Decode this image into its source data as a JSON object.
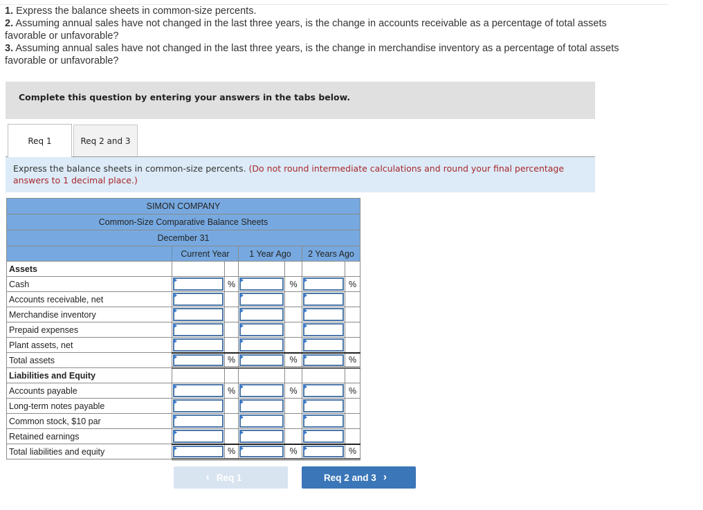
{
  "instructions": [
    {
      "num": "1.",
      "text": "Express the balance sheets in common-size percents."
    },
    {
      "num": "2.",
      "text": "Assuming annual sales have not changed in the last three years, is the change in accounts receivable as a percentage of total assets favorable or unfavorable?"
    },
    {
      "num": "3.",
      "text": "Assuming annual sales have not changed in the last three years, is the change in merchandise inventory as a percentage of total assets favorable or unfavorable?"
    }
  ],
  "banner": "Complete this question by entering your answers in the tabs below.",
  "tabs": [
    {
      "label": "Req 1",
      "active": true
    },
    {
      "label": "Req 2 and 3",
      "active": false
    }
  ],
  "prompt": {
    "text": "Express the balance sheets in common-size percents.",
    "note": "(Do not round intermediate calculations and round your final percentage answers to 1 decimal place.)"
  },
  "table": {
    "company": "SIMON COMPANY",
    "title": "Common-Size Comparative Balance Sheets",
    "date": "December 31",
    "columns": [
      "Current Year",
      "1 Year Ago",
      "2 Years Ago"
    ],
    "pct_symbol": "%",
    "rows": [
      {
        "label": "Assets",
        "type": "section"
      },
      {
        "label": "Cash",
        "type": "input",
        "pct": true,
        "values": [
          "",
          "",
          ""
        ]
      },
      {
        "label": "Accounts receivable, net",
        "type": "input",
        "pct": false,
        "values": [
          "",
          "",
          ""
        ]
      },
      {
        "label": "Merchandise inventory",
        "type": "input",
        "pct": false,
        "values": [
          "",
          "",
          ""
        ]
      },
      {
        "label": "Prepaid expenses",
        "type": "input",
        "pct": false,
        "values": [
          "",
          "",
          ""
        ]
      },
      {
        "label": "Plant assets, net",
        "type": "input",
        "pct": false,
        "values": [
          "",
          "",
          ""
        ]
      },
      {
        "label": "Total assets",
        "type": "total",
        "pct": true,
        "values": [
          "",
          "",
          ""
        ]
      },
      {
        "label": "Liabilities and Equity",
        "type": "section"
      },
      {
        "label": "Accounts payable",
        "type": "input",
        "pct": true,
        "values": [
          "",
          "",
          ""
        ]
      },
      {
        "label": "Long-term notes payable",
        "type": "input",
        "pct": false,
        "values": [
          "",
          "",
          ""
        ]
      },
      {
        "label": "Common stock, $10 par",
        "type": "input",
        "pct": false,
        "values": [
          "",
          "",
          ""
        ]
      },
      {
        "label": "Retained earnings",
        "type": "input",
        "pct": false,
        "values": [
          "",
          "",
          ""
        ]
      },
      {
        "label": "Total liabilities and equity",
        "type": "total",
        "pct": true,
        "values": [
          "",
          "",
          ""
        ]
      }
    ]
  },
  "nav": {
    "prev_label": "Req 1",
    "next_label": "Req 2 and 3",
    "prev_icon": "chevron-left-icon",
    "next_icon": "chevron-right-icon"
  },
  "colors": {
    "header_blue": "#77a9e0",
    "prompt_bg": "#dcebf7",
    "note_red": "#a8262b",
    "next_button": "#3a76b8",
    "prev_button_disabled": "#d9e4f1"
  }
}
